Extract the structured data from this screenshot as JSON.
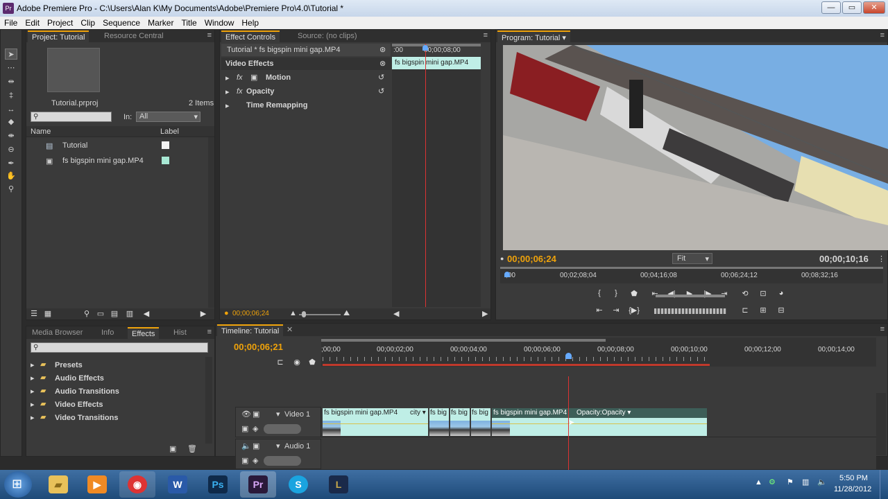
{
  "window": {
    "title": "Adobe Premiere Pro - C:\\Users\\Alan K\\My Documents\\Adobe\\Premiere Pro\\4.0\\Tutorial *",
    "app_icon": "Pr",
    "buttons": [
      "—",
      "▭",
      "✕"
    ]
  },
  "menu": [
    "File",
    "Edit",
    "Project",
    "Clip",
    "Sequence",
    "Marker",
    "Title",
    "Window",
    "Help"
  ],
  "tools": [
    "selection-tool",
    "track-select-tool",
    "ripple-edit-tool",
    "rolling-edit-tool",
    "rate-stretch-tool",
    "razor-tool",
    "slip-tool",
    "slide-tool",
    "pen-tool",
    "hand-tool",
    "zoom-tool"
  ],
  "project_panel": {
    "tabs": [
      "Project: Tutorial",
      "Resource Central"
    ],
    "filename": "Tutorial.prproj",
    "item_count": "2 Items",
    "in_label": "In:",
    "in_value": "All",
    "columns": [
      "Name",
      "Label"
    ],
    "items": [
      {
        "name": "Tutorial",
        "label_color": "#f2f2f2"
      },
      {
        "name": "fs bigspin mini gap.MP4",
        "label_color": "#a8e8d4"
      }
    ]
  },
  "effect_controls": {
    "tabs": [
      "Effect Controls",
      "Source: (no clips)"
    ],
    "clip_path": "Tutorial * fs bigspin mini gap.MP4",
    "section": "Video Effects",
    "effects": [
      "Motion",
      "Opacity",
      "Time Remapping"
    ],
    "ruler_start": ":00",
    "ruler_time": "00;00;08;00",
    "clip_label": "fs bigspin mini gap.MP4",
    "current_time": "00;00;06;24"
  },
  "program_monitor": {
    "tab": "Program: Tutorial",
    "current_time": "00;00;06;24",
    "duration": "00;00;10;16",
    "fit": "Fit",
    "ruler": [
      ";00",
      "00;02;08;04",
      "00;04;16;08",
      "00;06;24;12",
      "00;08;32;16"
    ]
  },
  "effects_panel": {
    "tabs": [
      "Media Browser",
      "Info",
      "Effects",
      "Hist"
    ],
    "folders": [
      "Presets",
      "Audio Effects",
      "Audio Transitions",
      "Video Effects",
      "Video Transitions"
    ]
  },
  "timeline": {
    "tab": "Timeline: Tutorial",
    "current_time": "00;00;06;21",
    "ruler": [
      ";00;00",
      "00;00;02;00",
      "00;00;04;00",
      "00;00;06;00",
      "00;00;08;00",
      "00;00;10;00",
      "00;00;12;00",
      "00;00;14;00"
    ],
    "tracks": [
      "Video 1",
      "Audio 1"
    ],
    "clip1_label": "fs bigspin mini gap.MP4",
    "clip1_tag": "city ▾",
    "short_clips": [
      "fs big",
      "fs big",
      "fs big"
    ],
    "clip2_label": "fs bigspin mini gap.MP4",
    "clip2_tag": "Opacity:Opacity ▾"
  },
  "taskbar": {
    "apps": [
      "windows-explorer",
      "media-player",
      "chrome",
      "word",
      "photoshop",
      "premiere",
      "skype",
      "league"
    ],
    "time": "5:50 PM",
    "date": "11/28/2012"
  }
}
